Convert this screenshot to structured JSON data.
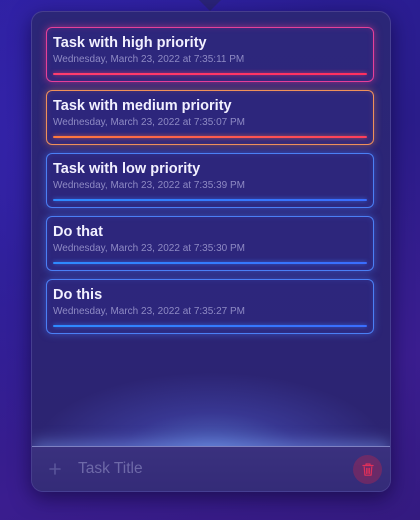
{
  "tasks": [
    {
      "title": "Task with high priority",
      "date": "Wednesday, March 23, 2022 at 7:35:11 PM",
      "priority": "high"
    },
    {
      "title": "Task with medium priority",
      "date": "Wednesday, March 23, 2022 at 7:35:07 PM",
      "priority": "medium"
    },
    {
      "title": "Task with low priority",
      "date": "Wednesday, March 23, 2022 at 7:35:39 PM",
      "priority": "low"
    },
    {
      "title": "Do that",
      "date": "Wednesday, March 23, 2022 at 7:35:30 PM",
      "priority": "low"
    },
    {
      "title": "Do this",
      "date": "Wednesday, March 23, 2022 at 7:35:27 PM",
      "priority": "low"
    }
  ],
  "input": {
    "placeholder": "Task Title",
    "value": ""
  },
  "icons": {
    "add": "plus-icon",
    "delete": "trash-icon"
  },
  "colors": {
    "high": "#ff3d6e",
    "medium": "#ff7a3d",
    "low": "#3a6dff",
    "delete": "#e0305a"
  }
}
